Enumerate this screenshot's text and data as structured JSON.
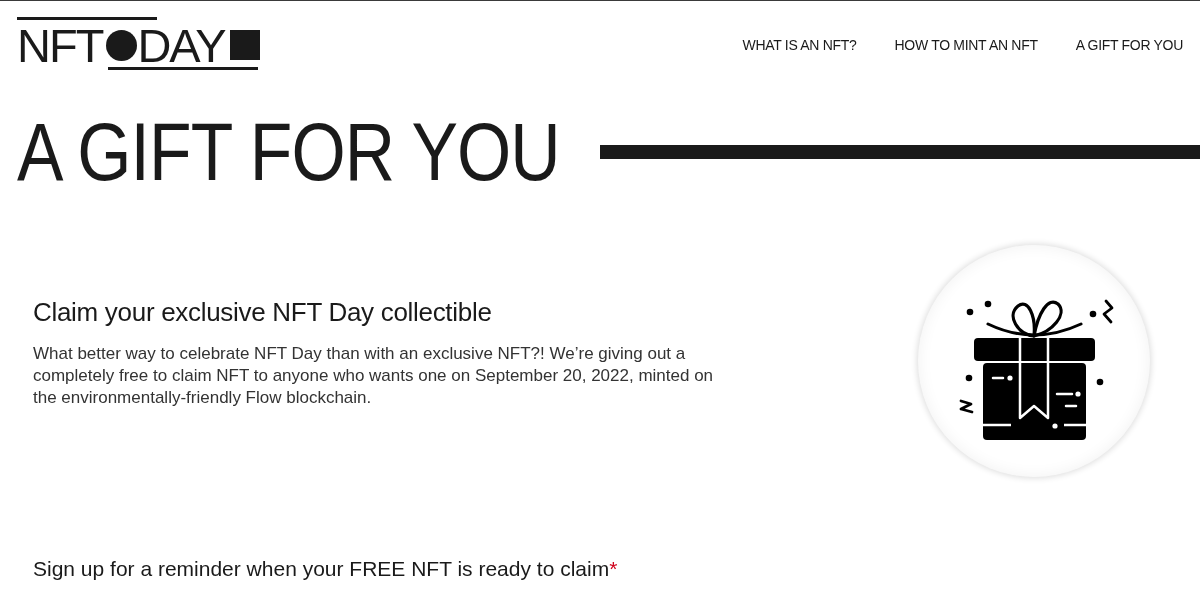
{
  "logo": {
    "text_left": "NFT",
    "text_right": "DAY"
  },
  "nav": [
    "WHAT IS AN NFT?",
    "HOW TO MINT AN NFT",
    "A GIFT FOR YOU"
  ],
  "hero": {
    "title": "A GIFT FOR YOU"
  },
  "intro": {
    "heading": "Claim your exclusive NFT Day collectible",
    "body": "What better way to celebrate NFT Day than with an exclusive NFT?! We’re giving out a completely free to claim NFT to anyone who wants one on September 20, 2022, minted on the environmentally-friendly Flow blockchain."
  },
  "signup": {
    "label": "Sign up for a reminder when your FREE NFT is ready to claim",
    "required_mark": "*"
  }
}
